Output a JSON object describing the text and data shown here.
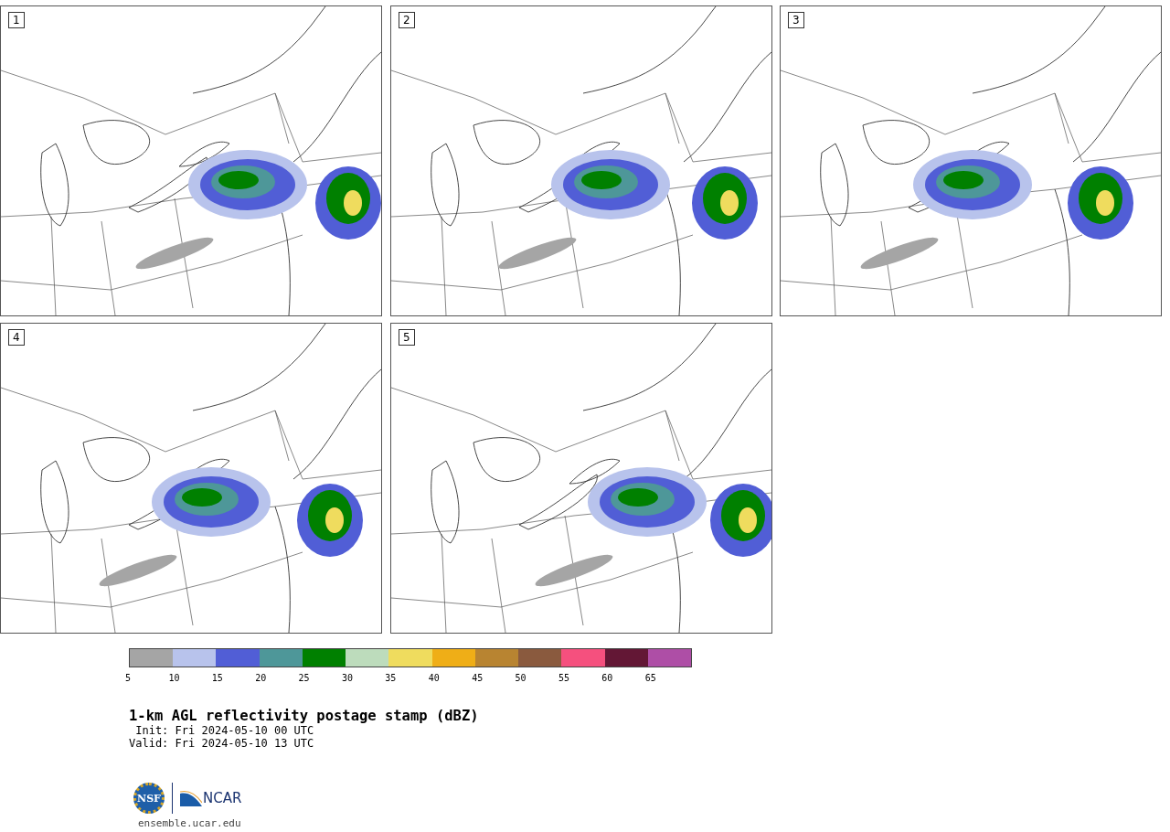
{
  "panels": [
    {
      "label": "1"
    },
    {
      "label": "2"
    },
    {
      "label": "3"
    },
    {
      "label": "4"
    },
    {
      "label": "5"
    }
  ],
  "colorbar": {
    "segments": [
      {
        "color": "#a5a5a5"
      },
      {
        "color": "#b8c3ec"
      },
      {
        "color": "#515ed6"
      },
      {
        "color": "#4e9799"
      },
      {
        "color": "#008000"
      },
      {
        "color": "#bddcbc"
      },
      {
        "color": "#efdc5e"
      },
      {
        "color": "#efae17"
      },
      {
        "color": "#b88431"
      },
      {
        "color": "#8a5a3e"
      },
      {
        "color": "#f5507e"
      },
      {
        "color": "#631735"
      },
      {
        "color": "#ae4ea6"
      }
    ],
    "ticks": [
      "5",
      "10",
      "15",
      "20",
      "25",
      "30",
      "35",
      "40",
      "45",
      "50",
      "55",
      "60",
      "65"
    ]
  },
  "title": "1-km AGL reflectivity postage stamp (dBZ)",
  "init": " Init: Fri 2024-05-10 00 UTC",
  "valid": "Valid: Fri 2024-05-10 13 UTC",
  "logo": {
    "nsf": "NSF",
    "ncar": "NCAR"
  },
  "url": "ensemble.ucar.edu"
}
